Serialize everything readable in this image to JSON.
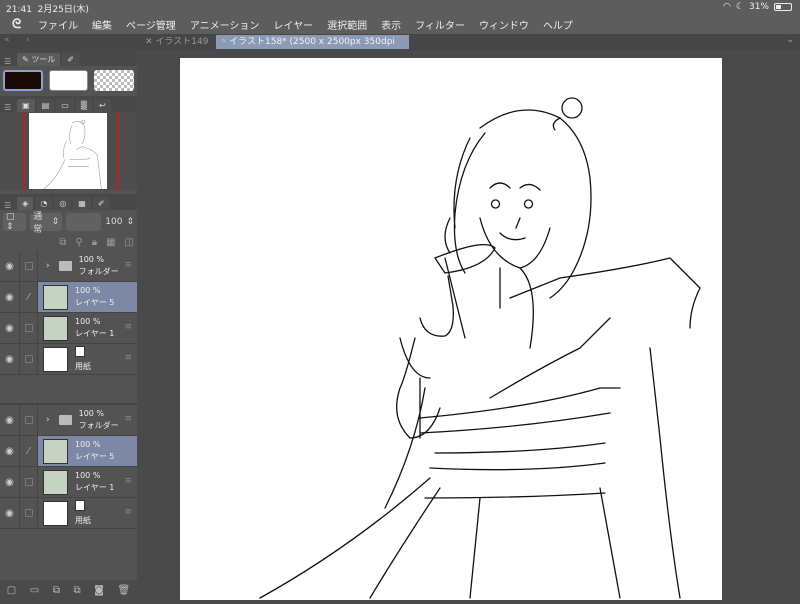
{
  "status": {
    "time": "21:41",
    "date": "2月25日(木)",
    "battery": "31%",
    "battery_level": 0.31
  },
  "menu": [
    "ファイル",
    "編集",
    "ページ管理",
    "アニメーション",
    "レイヤー",
    "選択範囲",
    "表示",
    "フィルター",
    "ウィンドウ",
    "ヘルプ"
  ],
  "tabs": {
    "inactive": "イラスト149",
    "active": "イラスト158* (2500 x 2500px 350dpi 55.5%)"
  },
  "tool_panel": {
    "tab": "ツール",
    "main_color": "#1a0a05",
    "sub_color": "#ffffff"
  },
  "layer_controls": {
    "blend": "通常",
    "opacity": "100"
  },
  "layers": [
    {
      "name": "フォルダー",
      "opacity": "100 %",
      "type": "folder",
      "selected": false
    },
    {
      "name": "レイヤー 5",
      "opacity": "100 %",
      "type": "raster",
      "selected": true
    },
    {
      "name": "レイヤー 1",
      "opacity": "100 %",
      "type": "raster",
      "selected": false
    },
    {
      "name": "用紙",
      "opacity": "",
      "type": "paper",
      "selected": false
    }
  ],
  "layers2": [
    {
      "name": "フォルダー",
      "opacity": "100 %",
      "type": "folder",
      "selected": false
    },
    {
      "name": "レイヤー 5",
      "opacity": "100 %",
      "type": "raster",
      "selected": true
    },
    {
      "name": "レイヤー 1",
      "opacity": "100 %",
      "type": "raster",
      "selected": false
    },
    {
      "name": "用紙",
      "opacity": "",
      "type": "paper",
      "selected": false
    }
  ]
}
